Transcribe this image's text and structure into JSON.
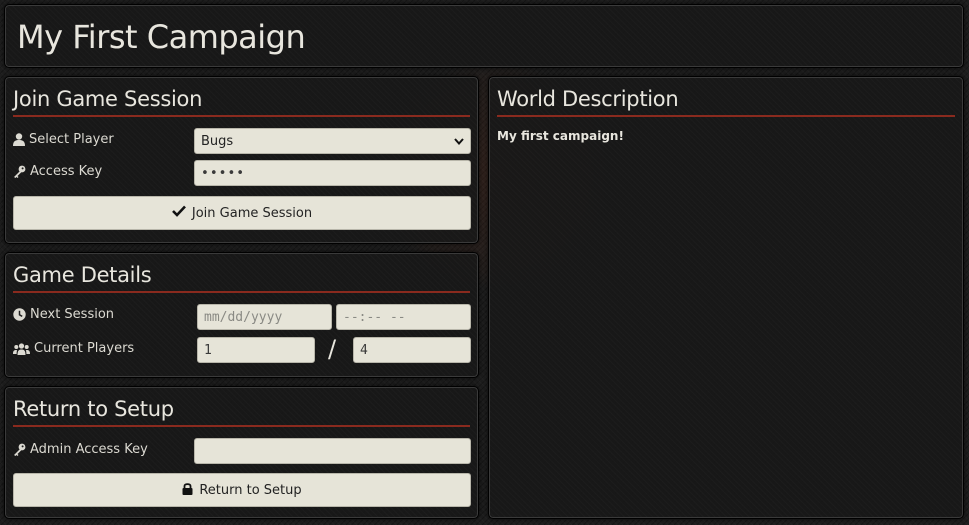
{
  "header": {
    "title": "My First Campaign"
  },
  "join": {
    "title": "Join Game Session",
    "player_label": "Select Player",
    "player_value": "Bugs",
    "key_label": "Access Key",
    "key_value": "•••••",
    "button_label": "Join Game Session"
  },
  "details": {
    "title": "Game Details",
    "next_label": "Next Session",
    "date_placeholder": "mm/dd/yyyy",
    "time_placeholder": "--:-- --",
    "players_label": "Current Players",
    "current_players": "1",
    "separator": "/",
    "max_players": "4"
  },
  "setup": {
    "title": "Return to Setup",
    "admin_label": "Admin Access Key",
    "admin_value": "",
    "button_label": "Return to Setup"
  },
  "world": {
    "title": "World Description",
    "text": "My first campaign!"
  },
  "colors": {
    "accent": "#8a2a1e",
    "field_bg": "#e6e4d8",
    "panel_bg": "#181818"
  },
  "icons": [
    "user-icon",
    "key-icon",
    "check-icon",
    "clock-icon",
    "users-icon",
    "lock-icon",
    "chevron-down-icon"
  ]
}
